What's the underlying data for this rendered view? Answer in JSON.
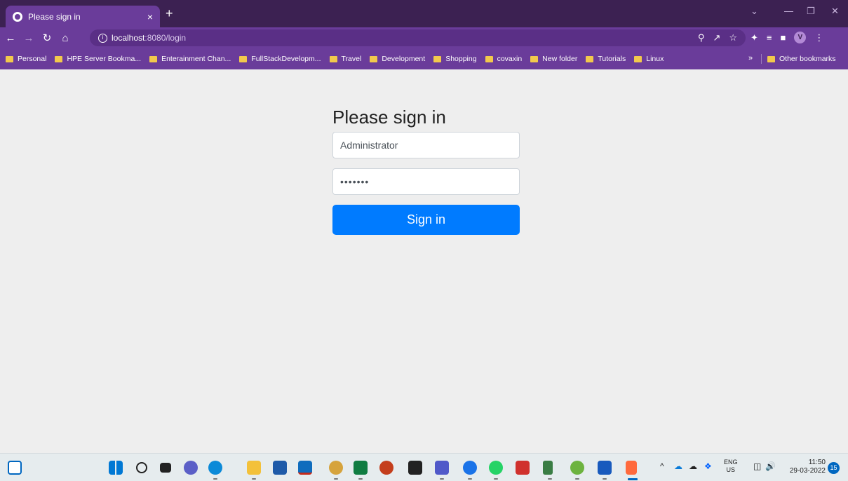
{
  "browser": {
    "tab_title": "Please sign in",
    "tab_close": "×",
    "new_tab": "+",
    "url_host": "localhost",
    "url_rest": ":8080/login",
    "bookmarks": [
      "Personal",
      "HPE Server Bookma...",
      "Enterainment Chan...",
      "FullStackDevelopm...",
      "Travel",
      "Development",
      "Shopping",
      "covaxin",
      "New folder",
      "Tutorials",
      "Linux"
    ],
    "bookmarks_more": "»",
    "other_bookmarks": "Other bookmarks",
    "profile_initial": "V"
  },
  "page": {
    "heading": "Please sign in",
    "username_value": "Administrator",
    "password_value": "•••••••",
    "signin_label": "Sign in"
  },
  "taskbar": {
    "lang_top": "ENG",
    "lang_bottom": "US",
    "time": "11:50",
    "date": "29-03-2022",
    "notification_count": "15",
    "apps": [
      "widgets-icon",
      "start-icon",
      "search-icon",
      "task-view-icon",
      "chat-icon",
      "edge-icon",
      "file-explorer-icon",
      "store-icon",
      "outlook-icon",
      "chrome-icon",
      "excel-icon",
      "powerpoint-icon",
      "sticky-notes-icon",
      "teams-icon",
      "chrome-profile-icon",
      "whatsapp-icon",
      "acrobat-icon",
      "git-icon",
      "spring-icon",
      "word-icon",
      "snipping-tool-icon"
    ]
  },
  "colors": {
    "accent": "#007bff",
    "chrome": "#6a3c9a",
    "titlebar": "#3c2152"
  }
}
